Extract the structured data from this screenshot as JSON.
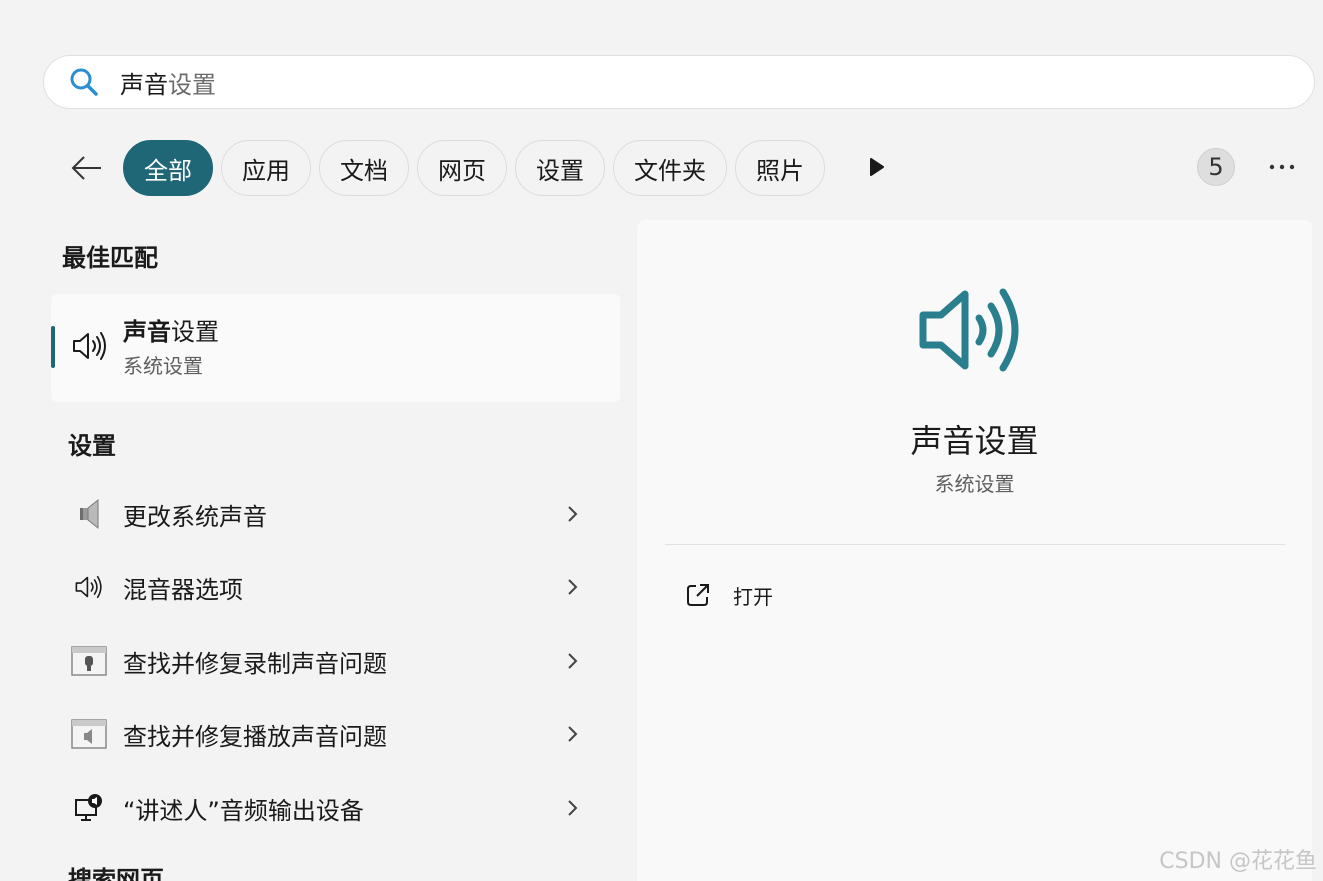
{
  "search": {
    "query_bold": "声音",
    "query_rest": "设置"
  },
  "filters": {
    "chips": [
      "全部",
      "应用",
      "文档",
      "网页",
      "设置",
      "文件夹",
      "照片"
    ],
    "count": "5"
  },
  "best_match": {
    "heading": "最佳匹配",
    "title_bold": "声音",
    "title_rest": "设置",
    "subtitle": "系统设置"
  },
  "settings": {
    "heading": "设置",
    "items": [
      {
        "label": "更改系统声音",
        "icon": "speaker-legacy-icon"
      },
      {
        "label": "混音器选项",
        "icon": "volume-icon"
      },
      {
        "label": "查找并修复录制声音问题",
        "icon": "troubleshoot-recording-icon"
      },
      {
        "label": "查找并修复播放声音问题",
        "icon": "troubleshoot-playback-icon"
      },
      {
        "label": "“讲述人”音频输出设备",
        "icon": "narrator-icon"
      }
    ]
  },
  "web_heading": "搜索网页",
  "detail": {
    "title": "声音设置",
    "subtitle": "系统设置",
    "open_label": "打开"
  },
  "watermark": "CSDN @花花鱼",
  "colors": {
    "accent": "#1f6677",
    "icon_teal": "#2a7f8f"
  }
}
